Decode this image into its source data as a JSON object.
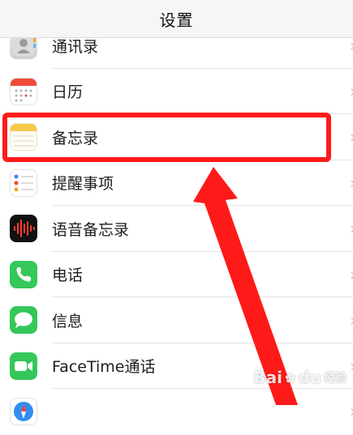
{
  "navbar": {
    "title": "设置"
  },
  "items": [
    {
      "label": "通讯录",
      "icon": "contacts-icon"
    },
    {
      "label": "日历",
      "icon": "calendar-icon"
    },
    {
      "label": "备忘录",
      "icon": "notes-icon"
    },
    {
      "label": "提醒事项",
      "icon": "reminders-icon"
    },
    {
      "label": "语音备忘录",
      "icon": "voice-memos-icon"
    },
    {
      "label": "电话",
      "icon": "phone-icon"
    },
    {
      "label": "信息",
      "icon": "messages-icon"
    },
    {
      "label": "FaceTime通话",
      "icon": "facetime-icon"
    },
    {
      "label": "",
      "icon": "safari-icon"
    }
  ],
  "watermark": {
    "brand": "Bai",
    "brand_suffix": "经验",
    "mark": "du"
  },
  "colors": {
    "highlight": "#ff1a1a",
    "arrow": "#ff1a1a",
    "phone_green": "#34c759",
    "facetime_green": "#34c759",
    "voice_memo_bg": "#111111"
  }
}
